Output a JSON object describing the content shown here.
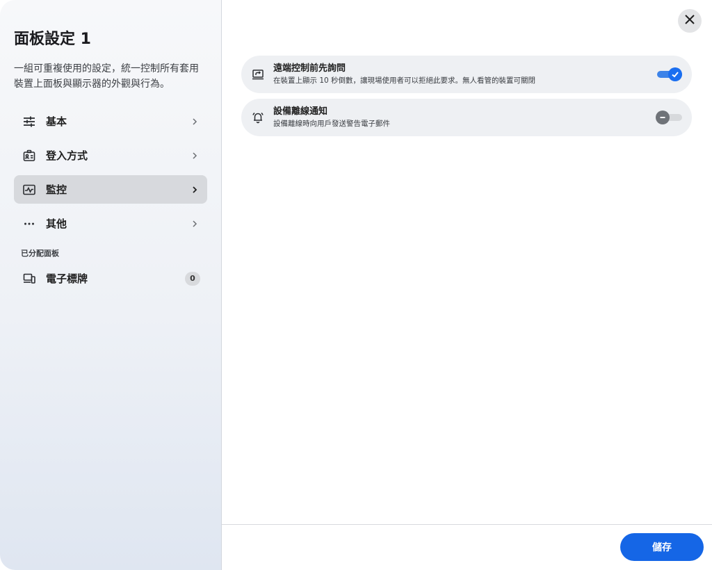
{
  "sidebar": {
    "title": "面板設定 1",
    "description": "一組可重複使用的設定，統一控制所有套用裝置上面板與顯示器的外觀與行為。",
    "nav_items": [
      {
        "label": "基本",
        "icon": "sliders-icon"
      },
      {
        "label": "登入方式",
        "icon": "id-badge-icon"
      },
      {
        "label": "監控",
        "icon": "monitoring-icon",
        "active": true
      },
      {
        "label": "其他",
        "icon": "more-horizontal-icon"
      }
    ],
    "assigned_section_label": "已分配面板",
    "assigned_items": [
      {
        "label": "電子標牌",
        "icon": "devices-icon",
        "count": "0"
      }
    ]
  },
  "main": {
    "settings": [
      {
        "icon": "remote-screen-icon",
        "title": "遠端控制前先詢問",
        "description": "在裝置上顯示 10 秒倒數，讓現場使用者可以拒絕此要求。無人看管的裝置可關閉",
        "enabled": true
      },
      {
        "icon": "bell-icon",
        "title": "設備離線通知",
        "description": "設備離線時向用戶發送警告電子郵件",
        "enabled": false
      }
    ],
    "save_label": "儲存"
  },
  "colors": {
    "accent": "#1566e6",
    "active_nav_bg": "#d7d9dd",
    "row_bg": "#eef0f3"
  }
}
